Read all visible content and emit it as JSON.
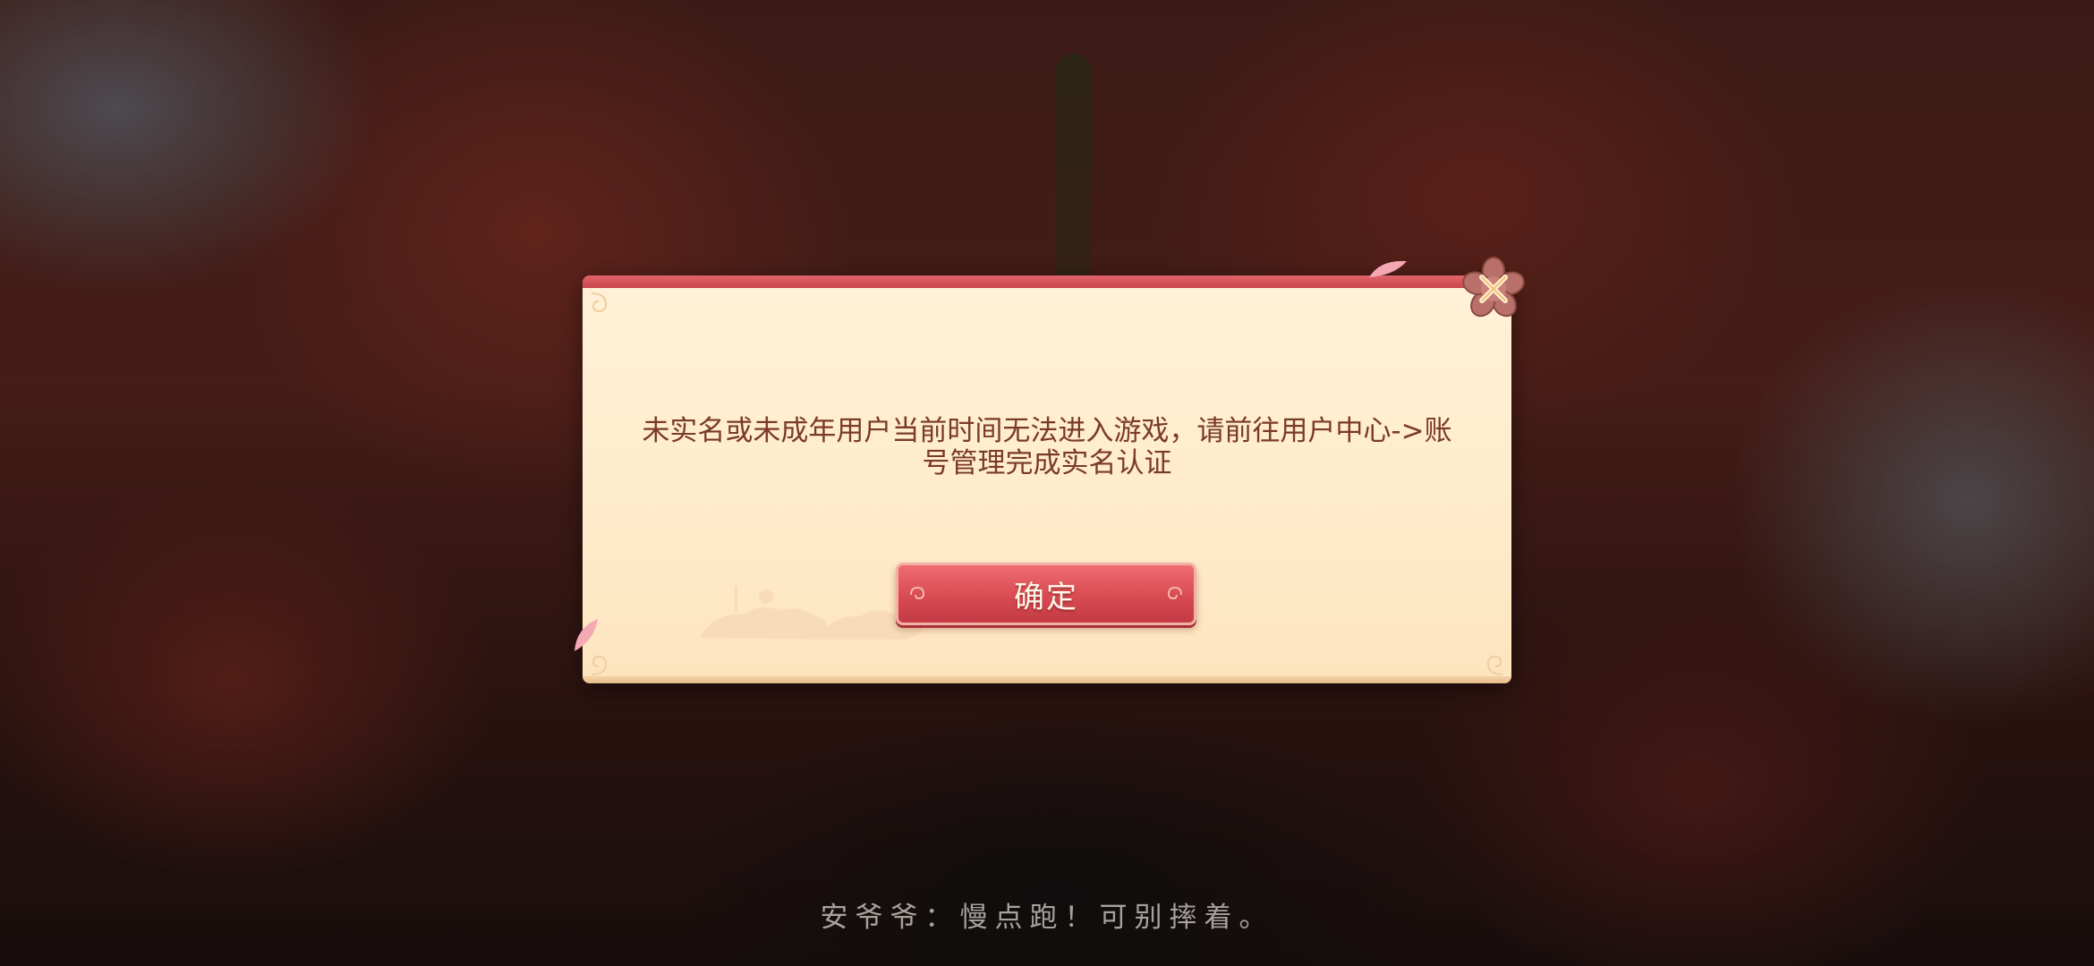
{
  "dialog": {
    "message": "未实名或未成年用户当前时间无法进入游戏，请前往用户中心->账号管理完成实名认证",
    "confirm_label": "确定",
    "close_icon": "close-flower-icon"
  },
  "subtitle": {
    "text": "安爷爷：慢点跑！可别摔着。"
  },
  "colors": {
    "dialog_bg": "#ffebcb",
    "accent_red": "#d94a52",
    "message_text": "#7a3a28",
    "subtitle_text": "#a8a29c"
  }
}
